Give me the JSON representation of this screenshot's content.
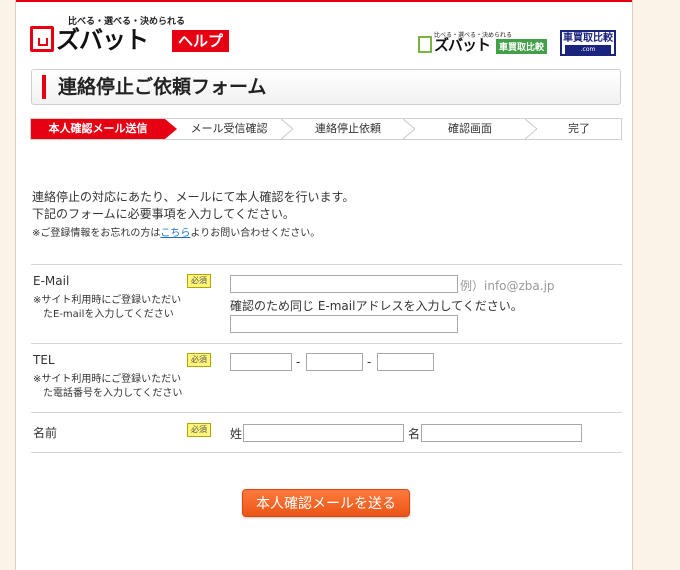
{
  "header": {
    "tagline": "比べる・選べる・決められる",
    "brand": "ズバット",
    "help_badge": "ヘルプ",
    "partner1": {
      "tagline": "比べる・選べる・決められる",
      "name": "ズバット",
      "badge": "車買取比較"
    },
    "partner2": {
      "name": "車買取比較",
      "sub": ".com"
    }
  },
  "title": "連絡停止ご依頼フォーム",
  "steps": [
    {
      "label": "本人確認メール送信",
      "active": true
    },
    {
      "label": "メール受信確認",
      "active": false
    },
    {
      "label": "連絡停止依頼",
      "active": false
    },
    {
      "label": "確認画面",
      "active": false
    },
    {
      "label": "完了",
      "active": false
    }
  ],
  "intro": {
    "line1": "連絡停止の対応にあたり、メールにて本人確認を行います。",
    "line2": "下記のフォームに必要事項を入力してください。",
    "note_before": "※ご登録情報をお忘れの方は",
    "note_link": "こちら",
    "note_after": "よりお問い合わせください。"
  },
  "form": {
    "required_badge": "必須",
    "email": {
      "label": "E-Mail",
      "note1": "※サイト利用時にご登録いただい",
      "note2": "たE-mailを入力してください",
      "value": "",
      "example": "例）info@zba.jp",
      "confirm_text": "確認のため同じ E-mailアドレスを入力してください。",
      "confirm_value": ""
    },
    "tel": {
      "label": "TEL",
      "note1": "※サイト利用時にご登録いただい",
      "note2": "た電話番号を入力してください",
      "separator": "-",
      "part1": "",
      "part2": "",
      "part3": ""
    },
    "name": {
      "label": "名前",
      "sei_label": "姓",
      "mei_label": "名",
      "sei_value": "",
      "mei_value": ""
    },
    "submit_label": "本人確認メールを送る"
  },
  "colors": {
    "accent_red": "#e60012",
    "submit_orange": "#ea5514",
    "required_yellow": "#fff57a",
    "link_blue": "#1a6fc4",
    "page_bg": "#faf3e8"
  }
}
